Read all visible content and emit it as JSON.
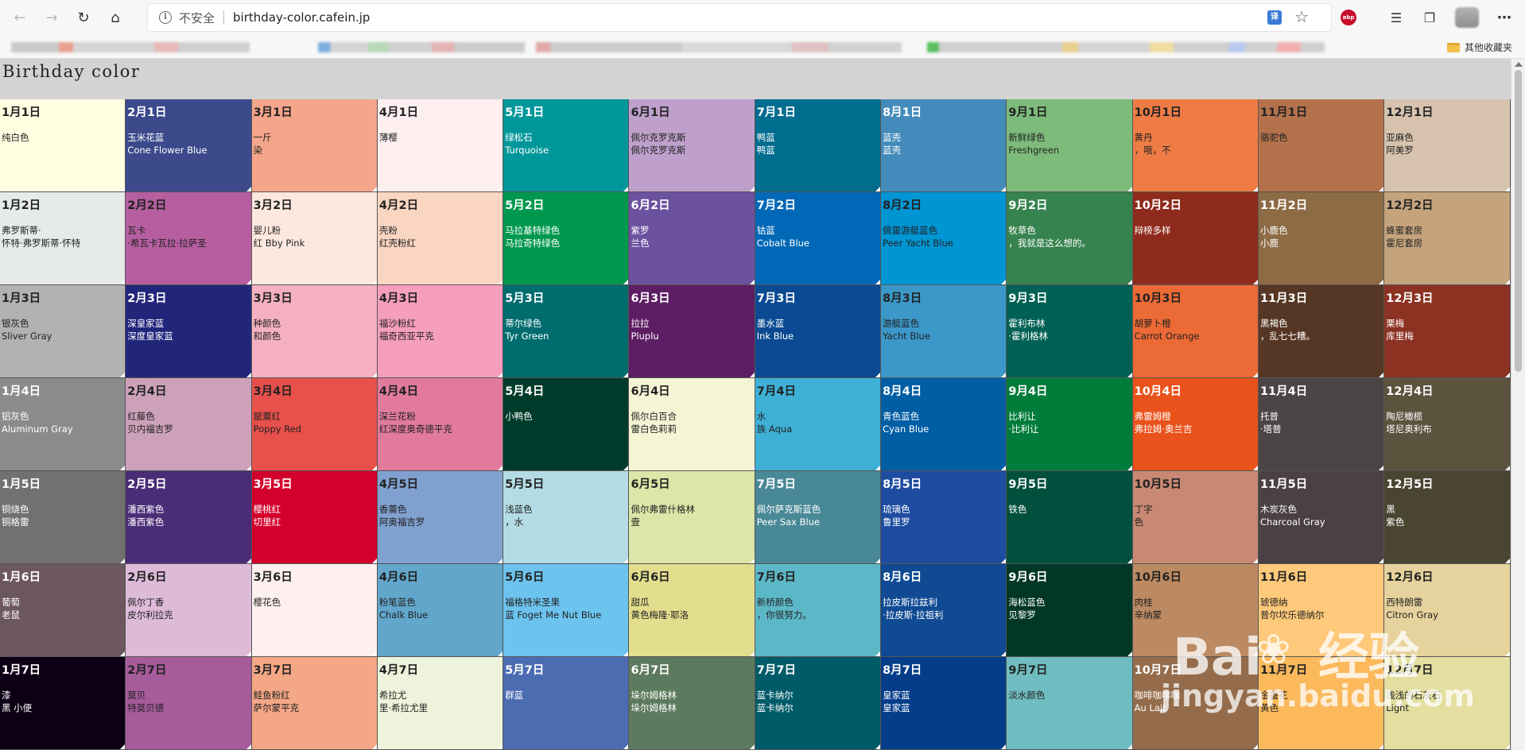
{
  "browser": {
    "security_label": "不安全",
    "url": "birthday-color.cafein.jp",
    "other_bookmarks": "其他收藏夹",
    "translate_icon": "translate-icon",
    "star_icon": "star-icon",
    "abp_icon": "abp"
  },
  "page": {
    "title": "Birthday color"
  },
  "watermark": {
    "logo": "Bai",
    "logo_cn": "经验",
    "url": "jingyan.baidu.com"
  },
  "grid": [
    [
      {
        "date": "1月1日",
        "name": [
          "纯白色"
        ],
        "bg": "#fffee0",
        "fg": "#222"
      },
      {
        "date": "2月1日",
        "name": [
          "玉米花蓝",
          "Cone Flower Blue"
        ],
        "bg": "#3c4a8c",
        "fg": "#fff"
      },
      {
        "date": "3月1日",
        "name": [
          "一斤",
          "染"
        ],
        "bg": "#f4a58a",
        "fg": "#222"
      },
      {
        "date": "4月1日",
        "name": [
          "薄樱"
        ],
        "bg": "#fdeef0",
        "fg": "#222"
      },
      {
        "date": "5月1日",
        "name": [
          "绿松石",
          "Turquoise"
        ],
        "bg": "#00979a",
        "fg": "#fff"
      },
      {
        "date": "6月1日",
        "name": [
          "佩尔克罗克斯",
          "佩尔克罗克斯"
        ],
        "bg": "#bea0cb",
        "fg": "#222"
      },
      {
        "date": "7月1日",
        "name": [
          "鸭蓝",
          "鸭蓝"
        ],
        "bg": "#006c8e",
        "fg": "#fff"
      },
      {
        "date": "8月1日",
        "name": [
          "蓝壳",
          "蓝壳"
        ],
        "bg": "#438bba",
        "fg": "#fff"
      },
      {
        "date": "9月1日",
        "name": [
          "新鲜绿色",
          "Freshgreen"
        ],
        "bg": "#7dbb7b",
        "fg": "#222"
      },
      {
        "date": "10月1日",
        "name": [
          "黄丹",
          "，哦，不"
        ],
        "bg": "#ef7c45",
        "fg": "#222"
      },
      {
        "date": "11月1日",
        "name": [
          "骆驼色"
        ],
        "bg": "#b4724c",
        "fg": "#222"
      },
      {
        "date": "12月1日",
        "name": [
          "亚麻色",
          "阿美罗"
        ],
        "bg": "#d7c3ad",
        "fg": "#222"
      }
    ],
    [
      {
        "date": "1月2日",
        "name": [
          "弗罗斯蒂·",
          "怀特·弗罗斯蒂·怀特"
        ],
        "bg": "#e6ebe8",
        "fg": "#222"
      },
      {
        "date": "2月2日",
        "name": [
          "瓦卡",
          "·希瓦卡瓦拉·拉萨圣"
        ],
        "bg": "#b65ea0",
        "fg": "#222"
      },
      {
        "date": "3月2日",
        "name": [
          "婴儿粉",
          "红 Bby Pink"
        ],
        "bg": "#fde8df",
        "fg": "#222"
      },
      {
        "date": "4月2日",
        "name": [
          "壳粉",
          "红壳粉红"
        ],
        "bg": "#fad5c1",
        "fg": "#222"
      },
      {
        "date": "5月2日",
        "name": [
          "马拉基特绿色",
          "马拉奇特绿色"
        ],
        "bg": "#00984f",
        "fg": "#fff"
      },
      {
        "date": "6月2日",
        "name": [
          "紫罗",
          "兰色"
        ],
        "bg": "#6c519f",
        "fg": "#fff"
      },
      {
        "date": "7月2日",
        "name": [
          "钴蓝",
          "Cobalt Blue"
        ],
        "bg": "#0068b6",
        "fg": "#fff"
      },
      {
        "date": "8月2日",
        "name": [
          "佩雷游艇蓝色",
          "Peer Yacht Blue"
        ],
        "bg": "#0095d3",
        "fg": "#222"
      },
      {
        "date": "9月2日",
        "name": [
          "牧草色",
          "，我就是这么想的。"
        ],
        "bg": "#37834f",
        "fg": "#fff"
      },
      {
        "date": "10月2日",
        "name": [
          "辩榜多样"
        ],
        "bg": "#8f2b1c",
        "fg": "#fff"
      },
      {
        "date": "11月2日",
        "name": [
          "小鹿色",
          "小鹿"
        ],
        "bg": "#8d6b45",
        "fg": "#fff"
      },
      {
        "date": "12月2日",
        "name": [
          "蜂蜜套房",
          "霍尼套房"
        ],
        "bg": "#c5a47d",
        "fg": "#222"
      }
    ],
    [
      {
        "date": "1月3日",
        "name": [
          "银灰色",
          "Sliver Gray"
        ],
        "bg": "#b2b2b2",
        "fg": "#222"
      },
      {
        "date": "2月3日",
        "name": [
          "深皇家蓝",
          "深度皇家蓝"
        ],
        "bg": "#22267b",
        "fg": "#fff"
      },
      {
        "date": "3月3日",
        "name": [
          "种颜色",
          "和颜色"
        ],
        "bg": "#f5b1c1",
        "fg": "#222"
      },
      {
        "date": "4月3日",
        "name": [
          "福沙粉红",
          "福奇西亚平克"
        ],
        "bg": "#f59ebd",
        "fg": "#222"
      },
      {
        "date": "5月3日",
        "name": [
          "蒂尔绿色",
          "Tyr Green"
        ],
        "bg": "#006c6e",
        "fg": "#fff"
      },
      {
        "date": "6月3日",
        "name": [
          "拉拉",
          "Pluplu"
        ],
        "bg": "#5c1d63",
        "fg": "#fff"
      },
      {
        "date": "7月3日",
        "name": [
          "墨水蓝",
          "Ink Blue"
        ],
        "bg": "#0b4a92",
        "fg": "#fff"
      },
      {
        "date": "8月3日",
        "name": [
          "游艇蓝色",
          "Yacht Blue"
        ],
        "bg": "#3b98c9",
        "fg": "#222"
      },
      {
        "date": "9月3日",
        "name": [
          "霍利布林",
          "·霍利格林"
        ],
        "bg": "#006154",
        "fg": "#fff"
      },
      {
        "date": "10月3日",
        "name": [
          "胡萝卜橙",
          "Carrot Orange"
        ],
        "bg": "#ec6a36",
        "fg": "#222"
      },
      {
        "date": "11月3日",
        "name": [
          "黑褐色",
          "，乱七七糟。"
        ],
        "bg": "#563624",
        "fg": "#fff"
      },
      {
        "date": "12月3日",
        "name": [
          "栗梅",
          "库里梅"
        ],
        "bg": "#8c3223",
        "fg": "#fff"
      }
    ],
    [
      {
        "date": "1月4日",
        "name": [
          "铝灰色",
          "Aluminum Gray"
        ],
        "bg": "#8a8c8b",
        "fg": "#fff"
      },
      {
        "date": "2月4日",
        "name": [
          "红藤色",
          "贝内福吉罗"
        ],
        "bg": "#cca1b9",
        "fg": "#222"
      },
      {
        "date": "3月4日",
        "name": [
          "罂粟红",
          "Poppy Red"
        ],
        "bg": "#e8504b",
        "fg": "#222"
      },
      {
        "date": "4月4日",
        "name": [
          "深兰花粉",
          "红深度奥奇德平克"
        ],
        "bg": "#e17a9b",
        "fg": "#222"
      },
      {
        "date": "5月4日",
        "name": [
          "小鸭色"
        ],
        "bg": "#003c2b",
        "fg": "#fff"
      },
      {
        "date": "6月4日",
        "name": [
          "佩尔白百合",
          "雷白色莉莉"
        ],
        "bg": "#f4f5d5",
        "fg": "#222"
      },
      {
        "date": "7月4日",
        "name": [
          "水",
          "族 Aqua"
        ],
        "bg": "#3eb0d5",
        "fg": "#222"
      },
      {
        "date": "8月4日",
        "name": [
          "青色蓝色",
          "Cyan Blue"
        ],
        "bg": "#005ea5",
        "fg": "#fff"
      },
      {
        "date": "9月4日",
        "name": [
          "比利让",
          "·比利让"
        ],
        "bg": "#007c3a",
        "fg": "#fff"
      },
      {
        "date": "10月4日",
        "name": [
          "弗雷姆橙",
          "弗拉姆·奥兰吉"
        ],
        "bg": "#e9521b",
        "fg": "#fff"
      },
      {
        "date": "11月4日",
        "name": [
          "托普",
          "·塔普"
        ],
        "bg": "#4c4546",
        "fg": "#fff"
      },
      {
        "date": "12月4日",
        "name": [
          "陶尼橄榄",
          "塔尼奥利布"
        ],
        "bg": "#5c533f",
        "fg": "#fff"
      }
    ],
    [
      {
        "date": "1月5日",
        "name": [
          "铜烧色",
          "铜格雷"
        ],
        "bg": "#737170",
        "fg": "#fff"
      },
      {
        "date": "2月5日",
        "name": [
          "潘西紫色",
          "潘西紫色"
        ],
        "bg": "#4b2d77",
        "fg": "#fff"
      },
      {
        "date": "3月5日",
        "name": [
          "樱桃红",
          "切里红"
        ],
        "bg": "#d3002c",
        "fg": "#fff"
      },
      {
        "date": "4月5日",
        "name": [
          "香薷色",
          "阿奥福吉罗"
        ],
        "bg": "#80a0d0",
        "fg": "#222"
      },
      {
        "date": "5月5日",
        "name": [
          "浅蓝色",
          "，水"
        ],
        "bg": "#b4dce5",
        "fg": "#222"
      },
      {
        "date": "6月5日",
        "name": [
          "佩尔弗雷什格林",
          "壹"
        ],
        "bg": "#dbe6a8",
        "fg": "#222"
      },
      {
        "date": "7月5日",
        "name": [
          "佩尔萨克斯蓝色",
          "Peer Sax Blue"
        ],
        "bg": "#498896",
        "fg": "#fff"
      },
      {
        "date": "8月5日",
        "name": [
          "琉璃色",
          "鲁里罗"
        ],
        "bg": "#1d4ca0",
        "fg": "#fff"
      },
      {
        "date": "9月5日",
        "name": [
          "铁色"
        ],
        "bg": "#00503d",
        "fg": "#fff"
      },
      {
        "date": "10月5日",
        "name": [
          "丁字",
          "色"
        ],
        "bg": "#c88873",
        "fg": "#222"
      },
      {
        "date": "11月5日",
        "name": [
          "木炭灰色",
          "Charcoal Gray"
        ],
        "bg": "#4b4045",
        "fg": "#fff"
      },
      {
        "date": "12月5日",
        "name": [
          "黑",
          "紫色"
        ],
        "bg": "#4a4531",
        "fg": "#fff"
      }
    ],
    [
      {
        "date": "1月6日",
        "name": [
          "葡萄",
          "老鼠"
        ],
        "bg": "#6c565f",
        "fg": "#fff"
      },
      {
        "date": "2月6日",
        "name": [
          "佩尔丁香",
          "皮尔利拉克"
        ],
        "bg": "#debad9",
        "fg": "#222"
      },
      {
        "date": "3月6日",
        "name": [
          "樱花色"
        ],
        "bg": "#fdf0ef",
        "fg": "#222"
      },
      {
        "date": "4月6日",
        "name": [
          "粉笔蓝色",
          "Chalk Blue"
        ],
        "bg": "#62a6cb",
        "fg": "#222"
      },
      {
        "date": "5月6日",
        "name": [
          "福格特米圣果",
          "蓝 Foget Me Nut Blue"
        ],
        "bg": "#6cc3ee",
        "fg": "#222"
      },
      {
        "date": "6月6日",
        "name": [
          "甜瓜",
          "黄色梅隆·耶洛"
        ],
        "bg": "#e3de8d",
        "fg": "#222"
      },
      {
        "date": "7月6日",
        "name": [
          "新桥颜色",
          "，你很努力。"
        ],
        "bg": "#5cb8c7",
        "fg": "#222"
      },
      {
        "date": "8月6日",
        "name": [
          "拉皮斯拉兹利",
          "·拉皮斯·拉祖利"
        ],
        "bg": "#0f4a93",
        "fg": "#fff"
      },
      {
        "date": "9月6日",
        "name": [
          "海松蓝色",
          "见黎罗"
        ],
        "bg": "#003727",
        "fg": "#fff"
      },
      {
        "date": "10月6日",
        "name": [
          "肉桂",
          "辛纳蒙"
        ],
        "bg": "#bc8a62",
        "fg": "#222"
      },
      {
        "date": "11月6日",
        "name": [
          "琥德纳",
          "普尔坎乐德纳尔"
        ],
        "bg": "#fec97a",
        "fg": "#222"
      },
      {
        "date": "12月6日",
        "name": [
          "西特朗雷",
          "Citron Gray"
        ],
        "bg": "#e6d29c",
        "fg": "#222"
      }
    ],
    [
      {
        "date": "1月7日",
        "name": [
          "漆",
          "黑 小便"
        ],
        "bg": "#0d0015",
        "fg": "#fff"
      },
      {
        "date": "2月7日",
        "name": [
          "莫贝",
          "特莫贝德"
        ],
        "bg": "#a65b9b",
        "fg": "#222"
      },
      {
        "date": "3月7日",
        "name": [
          "鲑鱼粉红",
          "萨尔蒙平克"
        ],
        "bg": "#f4a785",
        "fg": "#222"
      },
      {
        "date": "4月7日",
        "name": [
          "希拉尤",
          "里·希拉尤里"
        ],
        "bg": "#eef4dc",
        "fg": "#222"
      },
      {
        "date": "5月7日",
        "name": [
          "群蓝"
        ],
        "bg": "#4c6cb2",
        "fg": "#fff"
      },
      {
        "date": "6月7日",
        "name": [
          "垛尔姆格林",
          "垛尔姆格林"
        ],
        "bg": "#5c7a5d",
        "fg": "#fff"
      },
      {
        "date": "7月7日",
        "name": [
          "蓝卡纳尔",
          "蓝卡纳尔"
        ],
        "bg": "#005b69",
        "fg": "#fff"
      },
      {
        "date": "8月7日",
        "name": [
          "皇家蓝",
          "皇家蓝"
        ],
        "bg": "#053d8a",
        "fg": "#fff"
      },
      {
        "date": "9月7日",
        "name": [
          "淡水颜色"
        ],
        "bg": "#70bdc1",
        "fg": "#222"
      },
      {
        "date": "10月7日",
        "name": [
          "咖啡咖啡咖",
          "Au Lait"
        ],
        "bg": "#946c4b",
        "fg": "#fff"
      },
      {
        "date": "11月7日",
        "name": [
          "金盏花",
          "黄色"
        ],
        "bg": "#fbb95c",
        "fg": "#222"
      },
      {
        "date": "12月7日",
        "name": [
          "浅浅的石灰石",
          "Light"
        ],
        "bg": "#e4dea0",
        "fg": "#222"
      }
    ]
  ]
}
